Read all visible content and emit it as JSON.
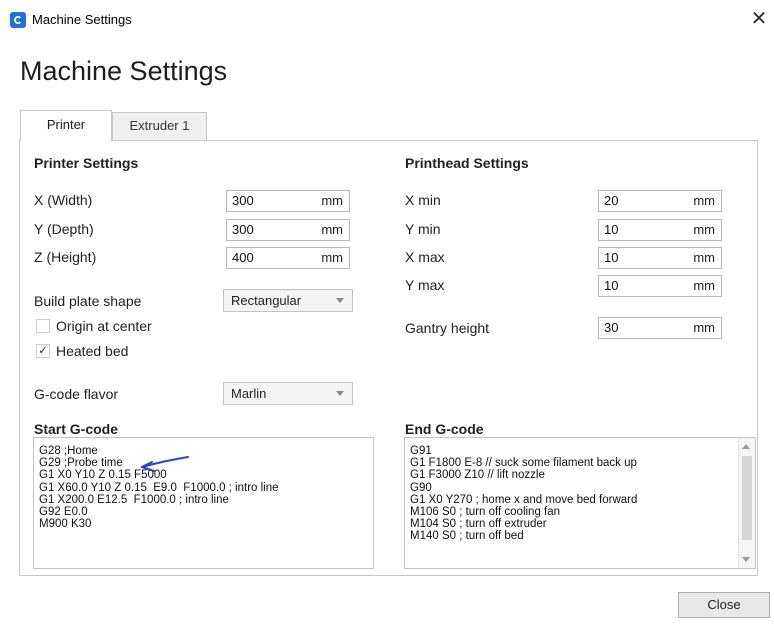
{
  "window": {
    "title": "Machine Settings",
    "close_glyph": "✕"
  },
  "page_title": "Machine Settings",
  "tabs": [
    {
      "label": "Printer",
      "active": true
    },
    {
      "label": "Extruder 1",
      "active": false
    }
  ],
  "printer_settings": {
    "heading": "Printer Settings",
    "x_width": {
      "label": "X (Width)",
      "value": "300",
      "unit": "mm"
    },
    "y_depth": {
      "label": "Y (Depth)",
      "value": "300",
      "unit": "mm"
    },
    "z_height": {
      "label": "Z (Height)",
      "value": "400",
      "unit": "mm"
    },
    "build_plate_shape": {
      "label": "Build plate shape",
      "value": "Rectangular"
    },
    "origin_at_center": {
      "label": "Origin at center",
      "checked": false
    },
    "heated_bed": {
      "label": "Heated bed",
      "checked": true,
      "mark": "✓"
    },
    "gcode_flavor": {
      "label": "G-code flavor",
      "value": "Marlin"
    }
  },
  "printhead_settings": {
    "heading": "Printhead Settings",
    "x_min": {
      "label": "X min",
      "value": "20",
      "unit": "mm"
    },
    "y_min": {
      "label": "Y min",
      "value": "10",
      "unit": "mm"
    },
    "x_max": {
      "label": "X max",
      "value": "10",
      "unit": "mm"
    },
    "y_max": {
      "label": "Y max",
      "value": "10",
      "unit": "mm"
    },
    "gantry_height": {
      "label": "Gantry height",
      "value": "30",
      "unit": "mm"
    }
  },
  "start_gcode": {
    "heading": "Start G-code",
    "lines": [
      "G28 ;Home",
      "G29 ;Probe time",
      "G1 X0 Y10 Z 0.15 F5000",
      "G1 X60.0 Y10 Z 0.15  E9.0  F1000.0 ; intro line",
      "G1 X200.0 E12.5  F1000.0 ; intro line",
      "G92 E0.0",
      "M900 K30"
    ]
  },
  "end_gcode": {
    "heading": "End G-code",
    "lines": [
      "G91",
      "G1 F1800 E-8 // suck some filament back up",
      "G1 F3000 Z10 // lift nozzle",
      "G90",
      "G1 X0 Y270 ; home x and move bed forward",
      "M106 S0 ; turn off cooling fan",
      "M104 S0 ; turn off extruder",
      "M140 S0 ; turn off bed"
    ]
  },
  "footer": {
    "close_label": "Close"
  },
  "colors": {
    "app_icon": "#1c74d6",
    "annotation_ink": "#2a3fd6"
  }
}
